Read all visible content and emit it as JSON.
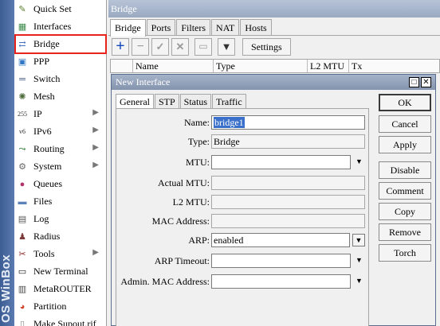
{
  "brand": "OS WinBox",
  "menu": [
    {
      "label": "Quick Set",
      "icon": "quick-set-icon",
      "glyph": "✎",
      "color": "#5a7f2e",
      "arrow": false
    },
    {
      "label": "Interfaces",
      "icon": "interfaces-icon",
      "glyph": "▦",
      "color": "#3c8a4c",
      "arrow": false
    },
    {
      "label": "Bridge",
      "icon": "bridge-icon",
      "glyph": "⇄",
      "color": "#2e5fb5",
      "arrow": false
    },
    {
      "label": "PPP",
      "icon": "ppp-icon",
      "glyph": "▣",
      "color": "#3278c4",
      "arrow": false
    },
    {
      "label": "Switch",
      "icon": "switch-icon",
      "glyph": "═",
      "color": "#314a78",
      "arrow": false
    },
    {
      "label": "Mesh",
      "icon": "mesh-icon",
      "glyph": "✺",
      "color": "#4f6e3d",
      "arrow": false
    },
    {
      "label": "IP",
      "icon": "ip-icon",
      "glyph": "255",
      "color": "#2a2a2a",
      "arrow": true
    },
    {
      "label": "IPv6",
      "icon": "ipv6-icon",
      "glyph": "v6",
      "color": "#2a2a2a",
      "arrow": true
    },
    {
      "label": "Routing",
      "icon": "routing-icon",
      "glyph": "⤳",
      "color": "#2f7d3a",
      "arrow": true
    },
    {
      "label": "System",
      "icon": "system-icon",
      "glyph": "⚙",
      "color": "#666666",
      "arrow": true
    },
    {
      "label": "Queues",
      "icon": "queues-icon",
      "glyph": "●",
      "color": "#b0336a",
      "arrow": false
    },
    {
      "label": "Files",
      "icon": "files-icon",
      "glyph": "▬",
      "color": "#5d82b8",
      "arrow": false
    },
    {
      "label": "Log",
      "icon": "log-icon",
      "glyph": "▤",
      "color": "#555555",
      "arrow": false
    },
    {
      "label": "Radius",
      "icon": "radius-icon",
      "glyph": "♟",
      "color": "#7c3a3a",
      "arrow": false
    },
    {
      "label": "Tools",
      "icon": "tools-icon",
      "glyph": "✂",
      "color": "#8a2b2b",
      "arrow": true
    },
    {
      "label": "New Terminal",
      "icon": "terminal-icon",
      "glyph": "▭",
      "color": "#222222",
      "arrow": false
    },
    {
      "label": "MetaROUTER",
      "icon": "metarouter-icon",
      "glyph": "▥",
      "color": "#4a4a4a",
      "arrow": false
    },
    {
      "label": "Partition",
      "icon": "partition-icon",
      "glyph": "◕",
      "color": "#d2452d",
      "arrow": false
    },
    {
      "label": "Make Supout.rif",
      "icon": "supout-icon",
      "glyph": "▯",
      "color": "#888888",
      "arrow": false
    }
  ],
  "bridge_window": {
    "title": "Bridge",
    "tabs": [
      "Bridge",
      "Ports",
      "Filters",
      "NAT",
      "Hosts"
    ],
    "settings_label": "Settings",
    "columns": [
      "",
      "Name",
      "Type",
      "L2 MTU",
      "Tx"
    ]
  },
  "dialog": {
    "title": "New Interface",
    "tabs": [
      "General",
      "STP",
      "Status",
      "Traffic"
    ],
    "fields": {
      "name_label": "Name:",
      "name_value": "bridge1",
      "type_label": "Type:",
      "type_value": "Bridge",
      "mtu_label": "MTU:",
      "mtu_value": "",
      "actual_mtu_label": "Actual MTU:",
      "actual_mtu_value": "",
      "l2_mtu_label": "L2 MTU:",
      "l2_mtu_value": "",
      "mac_label": "MAC Address:",
      "mac_value": "",
      "arp_label": "ARP:",
      "arp_value": "enabled",
      "arp_timeout_label": "ARP Timeout:",
      "arp_timeout_value": "",
      "admin_mac_label": "Admin. MAC Address:",
      "admin_mac_value": ""
    },
    "buttons": {
      "ok": "OK",
      "cancel": "Cancel",
      "apply": "Apply",
      "disable": "Disable",
      "comment": "Comment",
      "copy": "Copy",
      "remove": "Remove",
      "torch": "Torch"
    }
  }
}
